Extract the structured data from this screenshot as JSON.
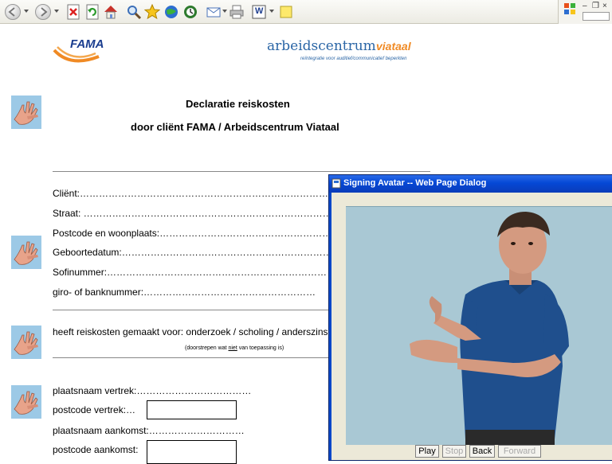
{
  "browser": {
    "toolbar_icons": [
      "back-icon",
      "forward-icon",
      "stop-icon",
      "refresh-icon",
      "home-icon",
      "search-icon",
      "favorites-icon",
      "media-icon",
      "history-icon",
      "mail-icon",
      "print-icon",
      "word-icon",
      "notes-icon"
    ],
    "word_glyph": "W",
    "window_controls": {
      "minimize": "–",
      "restore": "❐",
      "close": "×"
    }
  },
  "logos": {
    "fama": "FAMA",
    "viataal_brand": "arbeidscentrum",
    "viataal_name": "viataal",
    "viataal_tagline": "reïntegratie voor auditief/communicatief beperkten"
  },
  "form": {
    "title": "Declaratie reiskosten",
    "subtitle": "door cliënt FAMA / Arbeidscentrum Viataal",
    "fields_personal": [
      {
        "label": "Cliënt:……………………………………………………………………"
      },
      {
        "label": "Straat: ……………………………………………………………………"
      },
      {
        "label": "Postcode en woonplaats:…………………………………………………"
      },
      {
        "label": "Geboortedatum:…………………………………………………………"
      },
      {
        "label": "Sofinummer:……………………………………………………………"
      },
      {
        "label": "giro- of banknummer:………………………………………………"
      }
    ],
    "purpose_label": "heeft reiskosten gemaakt voor: onderzoek / scholing / anderszins:…",
    "strike_note_before": "(doorstrepen wat ",
    "strike_note_underlined": "niet",
    "strike_note_after": " van toepassing is)",
    "travel_fields": {
      "departure_place": "plaatsnaam vertrek:………………………………",
      "departure_postcode": "postcode vertrek:…",
      "arrival_place": "plaatsnaam aankomst:…………………………",
      "arrival_postcode": "postcode aankomst:"
    }
  },
  "dialog": {
    "title": "Signing Avatar -- Web Page Dialog",
    "buttons": {
      "play": "Play",
      "stop": "Stop",
      "back": "Back",
      "forward": "Forward"
    },
    "stop_enabled": false,
    "forward_enabled": false
  }
}
